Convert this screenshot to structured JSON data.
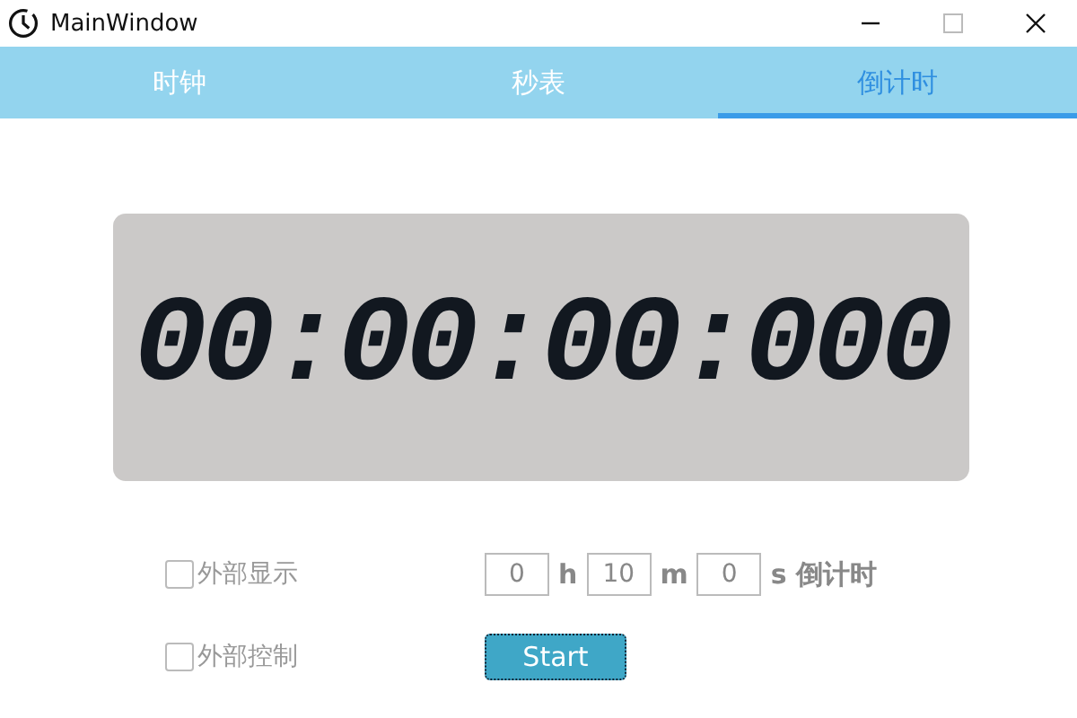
{
  "window": {
    "title": "MainWindow"
  },
  "tabs": [
    {
      "label": "时钟",
      "selected": false
    },
    {
      "label": "秒表",
      "selected": false
    },
    {
      "label": "倒计时",
      "selected": true
    }
  ],
  "display": {
    "time": "00:00:00:000"
  },
  "options": [
    {
      "label": "外部显示",
      "checked": false
    },
    {
      "label": "外部控制",
      "checked": false
    }
  ],
  "duration": {
    "fields": [
      {
        "value": "0",
        "unit": "h"
      },
      {
        "value": "10",
        "unit": "m"
      },
      {
        "value": "0",
        "unit": "s"
      }
    ],
    "label": "倒计时"
  },
  "start_button": {
    "label": "Start"
  }
}
